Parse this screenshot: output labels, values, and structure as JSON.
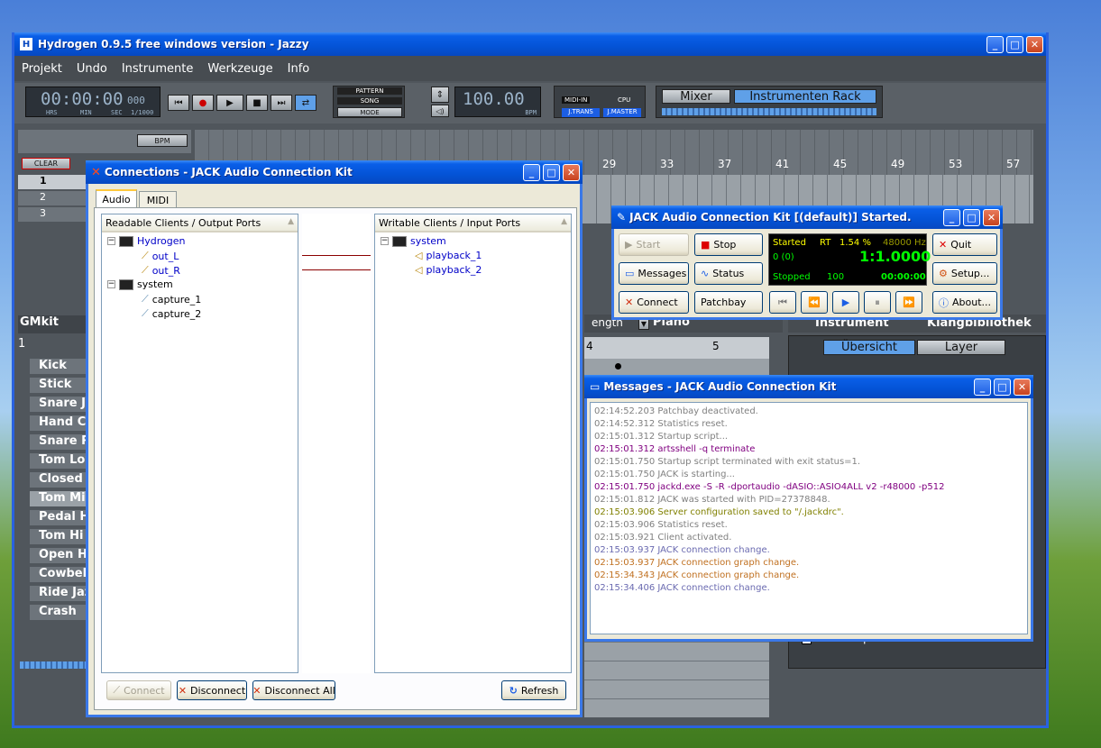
{
  "hydrogen": {
    "title": "Hydrogen 0.9.5 free windows version - Jazzy",
    "menu": [
      "Projekt",
      "Undo",
      "Instrumente",
      "Werkzeuge",
      "Info"
    ],
    "time": "00:00:00",
    "time_ms": "000",
    "time_units": [
      "HRS",
      "MIN",
      "SEC",
      "1/1000"
    ],
    "mode_labels": {
      "pattern": "PATTERN",
      "song": "SONG",
      "mode": "MODE"
    },
    "bpm": "100.00",
    "bpm_label": "BPM",
    "midi_in": "MIDI-IN",
    "cpu": "CPU",
    "jtrans": "J.TRANS",
    "jmaster": "J.MASTER",
    "mixer": "Mixer",
    "instrument_rack": "Instrumenten Rack",
    "bpm_btn": "BPM",
    "clear": "CLEAR",
    "ruler": [
      "29",
      "33",
      "37",
      "41",
      "45",
      "49",
      "53",
      "57"
    ],
    "song_rows": [
      "1",
      "2",
      "3"
    ],
    "kit": "GMkit",
    "pattern_num": "1",
    "instruments": [
      "Kick",
      "Stick",
      "Snare Jazz",
      "Hand Clap",
      "Snare Roll",
      "Tom Low",
      "Closed HH",
      "Tom Mid",
      "Pedal HH",
      "Tom Hi",
      "Open HH",
      "Cowbell",
      "Ride Jazz",
      "Crash"
    ],
    "pattern_length": "ength",
    "piano": "Piano",
    "grid_nums": [
      "4",
      "5"
    ],
    "tab_instrument": "Instrument",
    "tab_library": "Klangbibliothek",
    "ubersicht": "Übersicht",
    "layer": "Layer",
    "auto_stop": "Auto-Stop-Note"
  },
  "connections": {
    "title": "Connections - JACK Audio Connection Kit",
    "tabs": [
      "Audio",
      "MIDI"
    ],
    "readable_header": "Readable Clients / Output Ports",
    "writable_header": "Writable Clients / Input Ports",
    "readable": {
      "client1": "Hydrogen",
      "ports1": [
        "out_L",
        "out_R"
      ],
      "client2": "system",
      "ports2": [
        "capture_1",
        "capture_2"
      ]
    },
    "writable": {
      "client1": "system",
      "ports1": [
        "playback_1",
        "playback_2"
      ]
    },
    "buttons": {
      "connect": "Connect",
      "disconnect": "Disconnect",
      "disconnect_all": "Disconnect All",
      "refresh": "Refresh"
    }
  },
  "jack": {
    "title": "JACK Audio Connection Kit [(default)] Started.",
    "buttons": {
      "start": "Start",
      "stop": "Stop",
      "quit": "Quit",
      "messages": "Messages",
      "status": "Status",
      "setup": "Setup...",
      "connect": "Connect",
      "patchbay": "Patchbay",
      "about": "About..."
    },
    "display": {
      "state": "Started",
      "rt": "RT",
      "load": "1.54 %",
      "rate": "48000 Hz",
      "xruns": "0 (0)",
      "bbt": "1:1.0000",
      "transport": "Stopped",
      "bpm": "100",
      "time": "00:00:00"
    }
  },
  "messages": {
    "title": "Messages - JACK Audio Connection Kit",
    "lines": [
      {
        "t": "02:14:52.203 Patchbay deactivated.",
        "c": "#808080"
      },
      {
        "t": "02:14:52.312 Statistics reset.",
        "c": "#808080"
      },
      {
        "t": "02:15:01.312 Startup script...",
        "c": "#808080"
      },
      {
        "t": "02:15:01.312 artsshell -q terminate",
        "c": "#800080"
      },
      {
        "t": "02:15:01.750 Startup script terminated with exit status=1.",
        "c": "#808080"
      },
      {
        "t": "02:15:01.750 JACK is starting...",
        "c": "#808080"
      },
      {
        "t": "02:15:01.750 jackd.exe -S -R -dportaudio -dASIO::ASIO4ALL v2 -r48000 -p512",
        "c": "#800080"
      },
      {
        "t": "02:15:01.812 JACK was started with PID=27378848.",
        "c": "#808080"
      },
      {
        "t": "02:15:03.906 Server configuration saved to \"/.jackdrc\".",
        "c": "#808000"
      },
      {
        "t": "02:15:03.906 Statistics reset.",
        "c": "#808080"
      },
      {
        "t": "02:15:03.921 Client activated.",
        "c": "#808080"
      },
      {
        "t": "02:15:03.937 JACK connection change.",
        "c": "#6a6ab0"
      },
      {
        "t": "02:15:03.937 JACK connection graph change.",
        "c": "#c07020"
      },
      {
        "t": "02:15:34.343 JACK connection graph change.",
        "c": "#c07020"
      },
      {
        "t": "02:15:34.406 JACK connection change.",
        "c": "#6a6ab0"
      }
    ]
  }
}
